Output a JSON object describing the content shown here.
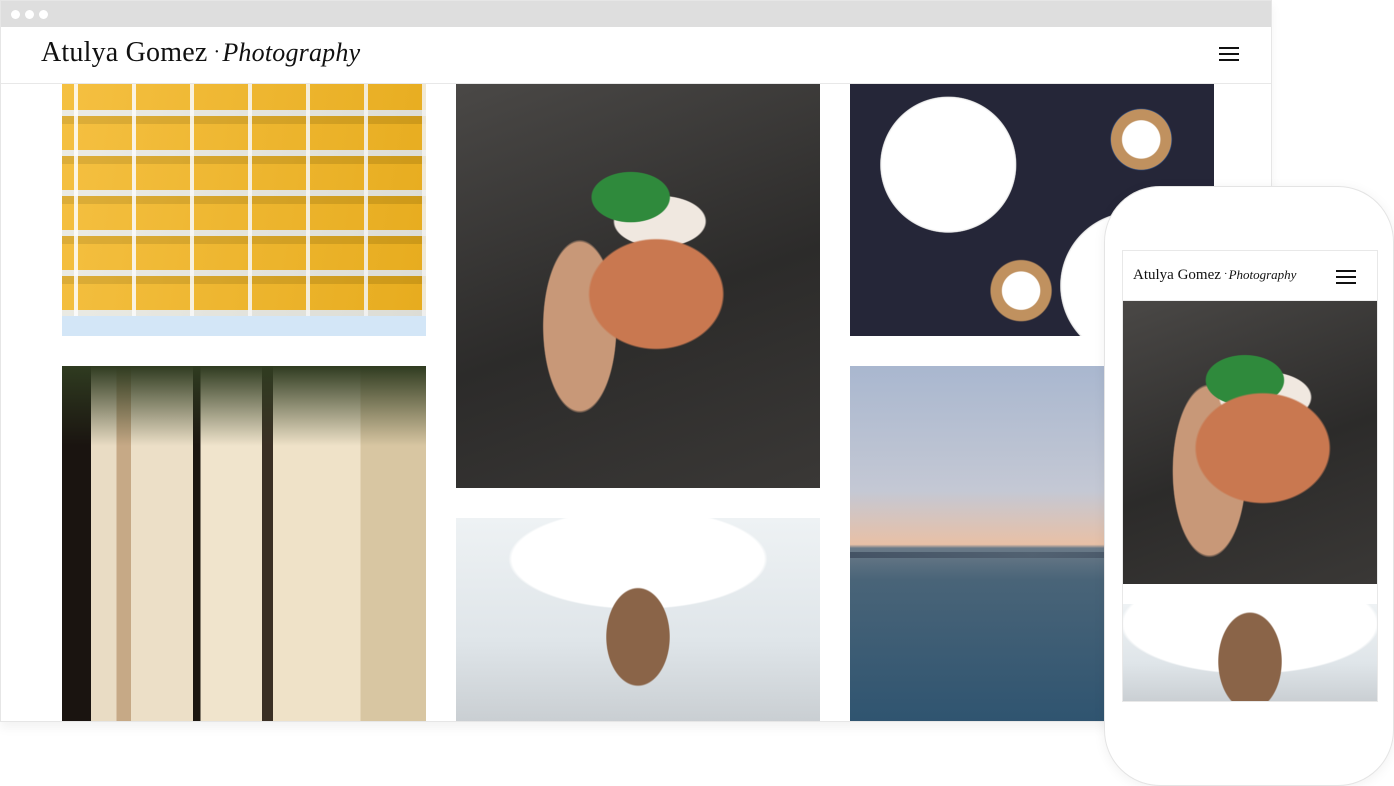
{
  "site": {
    "brand_name": "Atulya Gomez",
    "brand_separator": "·",
    "brand_subtitle": "Photography",
    "menu_icon": "hamburger-menu-icon"
  },
  "gallery": {
    "photos": [
      {
        "subject": "building",
        "description": ""
      },
      {
        "subject": "drink",
        "description": ""
      },
      {
        "subject": "food",
        "description": ""
      },
      {
        "subject": "books",
        "description": ""
      },
      {
        "subject": "girl",
        "description": ""
      },
      {
        "subject": "sea",
        "description": ""
      }
    ]
  },
  "mobile": {
    "brand_name": "Atulya Gomez",
    "brand_separator": "·",
    "brand_subtitle": "Photography",
    "menu_icon": "hamburger-menu-icon"
  },
  "colors": {
    "titlebar": "#dedede",
    "text": "#111111",
    "background": "#ffffff"
  }
}
